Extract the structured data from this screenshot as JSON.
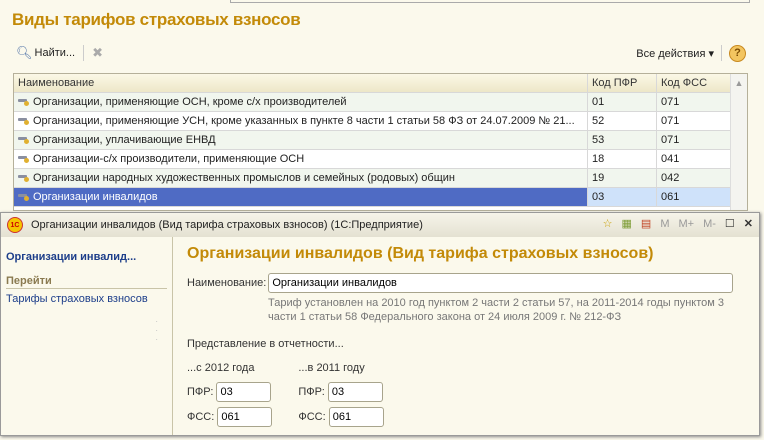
{
  "page": {
    "title": "Виды тарифов страховых взносов"
  },
  "toolbar": {
    "find": "Найти...",
    "all_actions": "Все действия ▾",
    "help": "?"
  },
  "table": {
    "headers": [
      "Наименование",
      "Код ПФР",
      "Код ФСС"
    ],
    "rows": [
      {
        "name": "Организации, применяющие ОСН, кроме с/х производителей",
        "pfr": "01",
        "fss": "071"
      },
      {
        "name": "Организации, применяющие УСН, кроме указанных в пункте 8 части 1 статьи 58 ФЗ от 24.07.2009 № 21...",
        "pfr": "52",
        "fss": "071"
      },
      {
        "name": "Организации, уплачивающие ЕНВД",
        "pfr": "53",
        "fss": "071"
      },
      {
        "name": "Организации-с/х производители, применяющие ОСН",
        "pfr": "18",
        "fss": "041"
      },
      {
        "name": "Организации народных художественных промыслов и семейных (родовых) общин",
        "pfr": "19",
        "fss": "042"
      },
      {
        "name": "Организации инвалидов",
        "pfr": "03",
        "fss": "061"
      }
    ],
    "selected_index": 5
  },
  "dialog": {
    "window_title": "Организации инвалидов (Вид тарифа страховых взносов)  (1С:Предприятие)",
    "logo": "1С",
    "title_buttons": [
      "M",
      "M+",
      "M-"
    ],
    "nav": {
      "current": "Организации инвалид...",
      "goto": "Перейти",
      "link": "Тарифы страховых взносов"
    },
    "heading": "Организации инвалидов (Вид тарифа страховых взносов)",
    "name_label": "Наименование:",
    "name_value": "Организации инвалидов",
    "note": "Тариф установлен на 2010 год пунктом 2 части 2 статьи 57, на 2011-2014 годы пунктом 3 части 1 статьи 58 Федерального закона от 24 июля 2009 г. № 212-ФЗ",
    "reporting_label": "Представление в отчетности...",
    "col2012": "...с 2012 года",
    "col2011": "...в 2011 году",
    "pfr_label": "ПФР:",
    "fss_label": "ФСС:",
    "pfr2012": "03",
    "fss2012": "061",
    "pfr2011": "03",
    "fss2011": "061"
  }
}
